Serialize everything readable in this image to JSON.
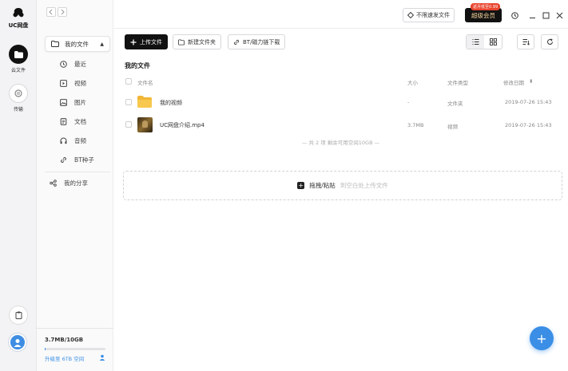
{
  "app": {
    "logo_text": "UC网盘"
  },
  "rail": {
    "items": [
      {
        "label": "云文件"
      },
      {
        "label": "传输"
      }
    ]
  },
  "sidebar": {
    "header": {
      "label": "我的文件"
    },
    "items": [
      {
        "label": "最近",
        "icon": "clock-icon"
      },
      {
        "label": "视频",
        "icon": "video-icon"
      },
      {
        "label": "图片",
        "icon": "image-icon"
      },
      {
        "label": "文档",
        "icon": "document-icon"
      },
      {
        "label": "音频",
        "icon": "headphones-icon"
      },
      {
        "label": "BT种子",
        "icon": "link-icon"
      }
    ],
    "share": {
      "label": "我的分享",
      "icon": "share-icon"
    }
  },
  "storage": {
    "used_text": "3.7MB/10GB",
    "used_fraction": 0.0004,
    "upgrade_label": "升级至 6TB 空间"
  },
  "titlebar": {
    "speed_button": "不限速发文件",
    "vip_label": "超级会员",
    "vip_badge": "返月低至0.99"
  },
  "toolbar": {
    "upload_label": "上传文件",
    "new_folder_label": "新建文件夹",
    "bt_label": "BT/磁力链下载"
  },
  "section_title": "我的文件",
  "table": {
    "headers": {
      "name": "文件名",
      "size": "大小",
      "type": "文件类型",
      "date": "修改日期"
    },
    "rows": [
      {
        "name": "我的视频",
        "size": "-",
        "type": "文件夹",
        "date": "2019-07-26 15:43",
        "icon": "folder-icon"
      },
      {
        "name": "UC网盘介绍.mp4",
        "size": "3.7MB",
        "type": "视频",
        "date": "2019-07-26 15:43",
        "icon": "video-thumbnail"
      }
    ]
  },
  "summary": "— 共 2 项 剩余可用空间10GB —",
  "dropzone": {
    "label": "拖拽/粘贴",
    "hint": "到空白处上传文件"
  },
  "colors": {
    "accent": "#3a8ee6",
    "dark": "#111111",
    "vip_text": "#f7d49a",
    "badge": "#e8442d"
  }
}
